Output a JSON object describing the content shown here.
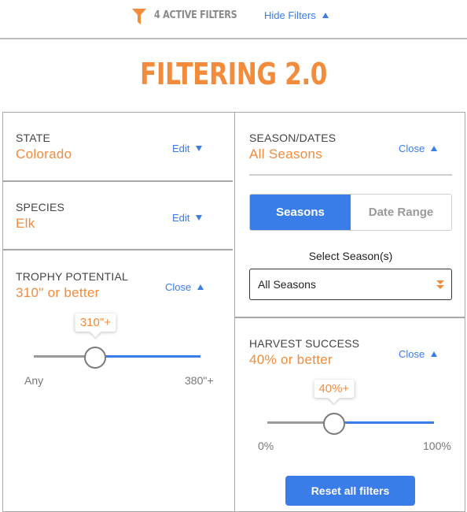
{
  "header": {
    "active_filters_label": "4 ACTIVE FILTERS",
    "toggle_label": "Hide Filters"
  },
  "page_title": "FILTERING 2.0",
  "state": {
    "label": "STATE",
    "value": "Colorado",
    "action": "Edit"
  },
  "species": {
    "label": "SPECIES",
    "value": "Elk",
    "action": "Edit"
  },
  "trophy": {
    "label": "TROPHY POTENTIAL",
    "value": "310\" or better",
    "action": "Close",
    "slider_bubble": "310\"+",
    "min_label": "Any",
    "max_label": "380\"+",
    "slider_fraction": 0.37
  },
  "season": {
    "label": "SEASON/DATES",
    "value": "All Seasons",
    "action": "Close",
    "toggle_options": [
      "Seasons",
      "Date Range"
    ],
    "toggle_selected": "Seasons",
    "select_label": "Select Season(s)",
    "select_value": "All Seasons"
  },
  "harvest": {
    "label": "HARVEST SUCCESS",
    "value": "40% or better",
    "action": "Close",
    "slider_bubble": "40%+",
    "min_label": "0%",
    "max_label": "100%",
    "slider_fraction": 0.4
  },
  "reset_label": "Reset all filters",
  "colors": {
    "accent_orange": "#f28b3c",
    "link_blue": "#3b7de8",
    "border_gray": "#a8a8a8"
  }
}
